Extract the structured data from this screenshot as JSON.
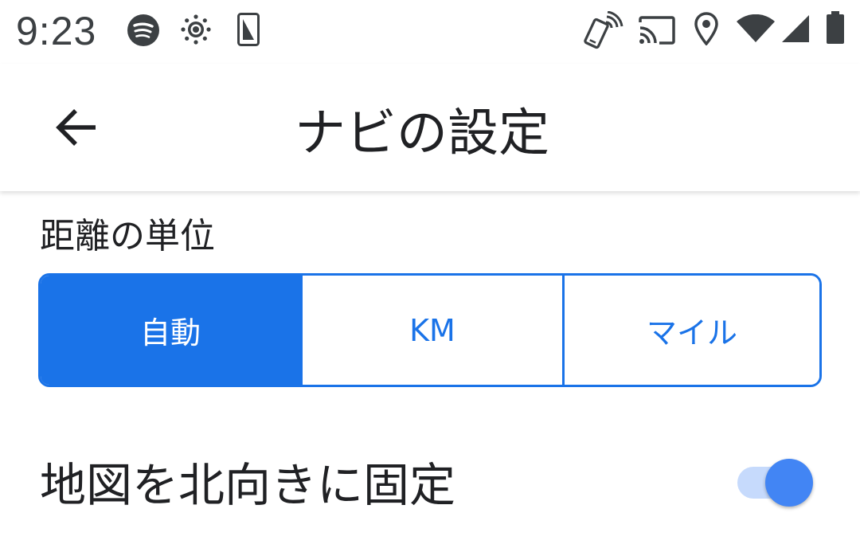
{
  "status_bar": {
    "time": "9:23",
    "left_icons": [
      "spotify-icon",
      "brightness-icon",
      "screenshot-icon"
    ],
    "right_icons": [
      "nfc-phone-icon",
      "cast-icon",
      "location-icon",
      "wifi-icon",
      "signal-icon",
      "battery-icon"
    ]
  },
  "app_bar": {
    "back_icon": "arrow-back-icon",
    "title": "ナビの設定"
  },
  "distance_unit": {
    "label": "距離の単位",
    "options": [
      "自動",
      "KM",
      "マイル"
    ],
    "selected": "自動"
  },
  "north_up": {
    "label": "地図を北向きに固定",
    "enabled": true
  },
  "colors": {
    "accent": "#1a73e8",
    "switch_thumb": "#4285f4",
    "switch_track": "#c6dafc",
    "text_primary": "#202124",
    "status_icons": "#3c4043"
  }
}
